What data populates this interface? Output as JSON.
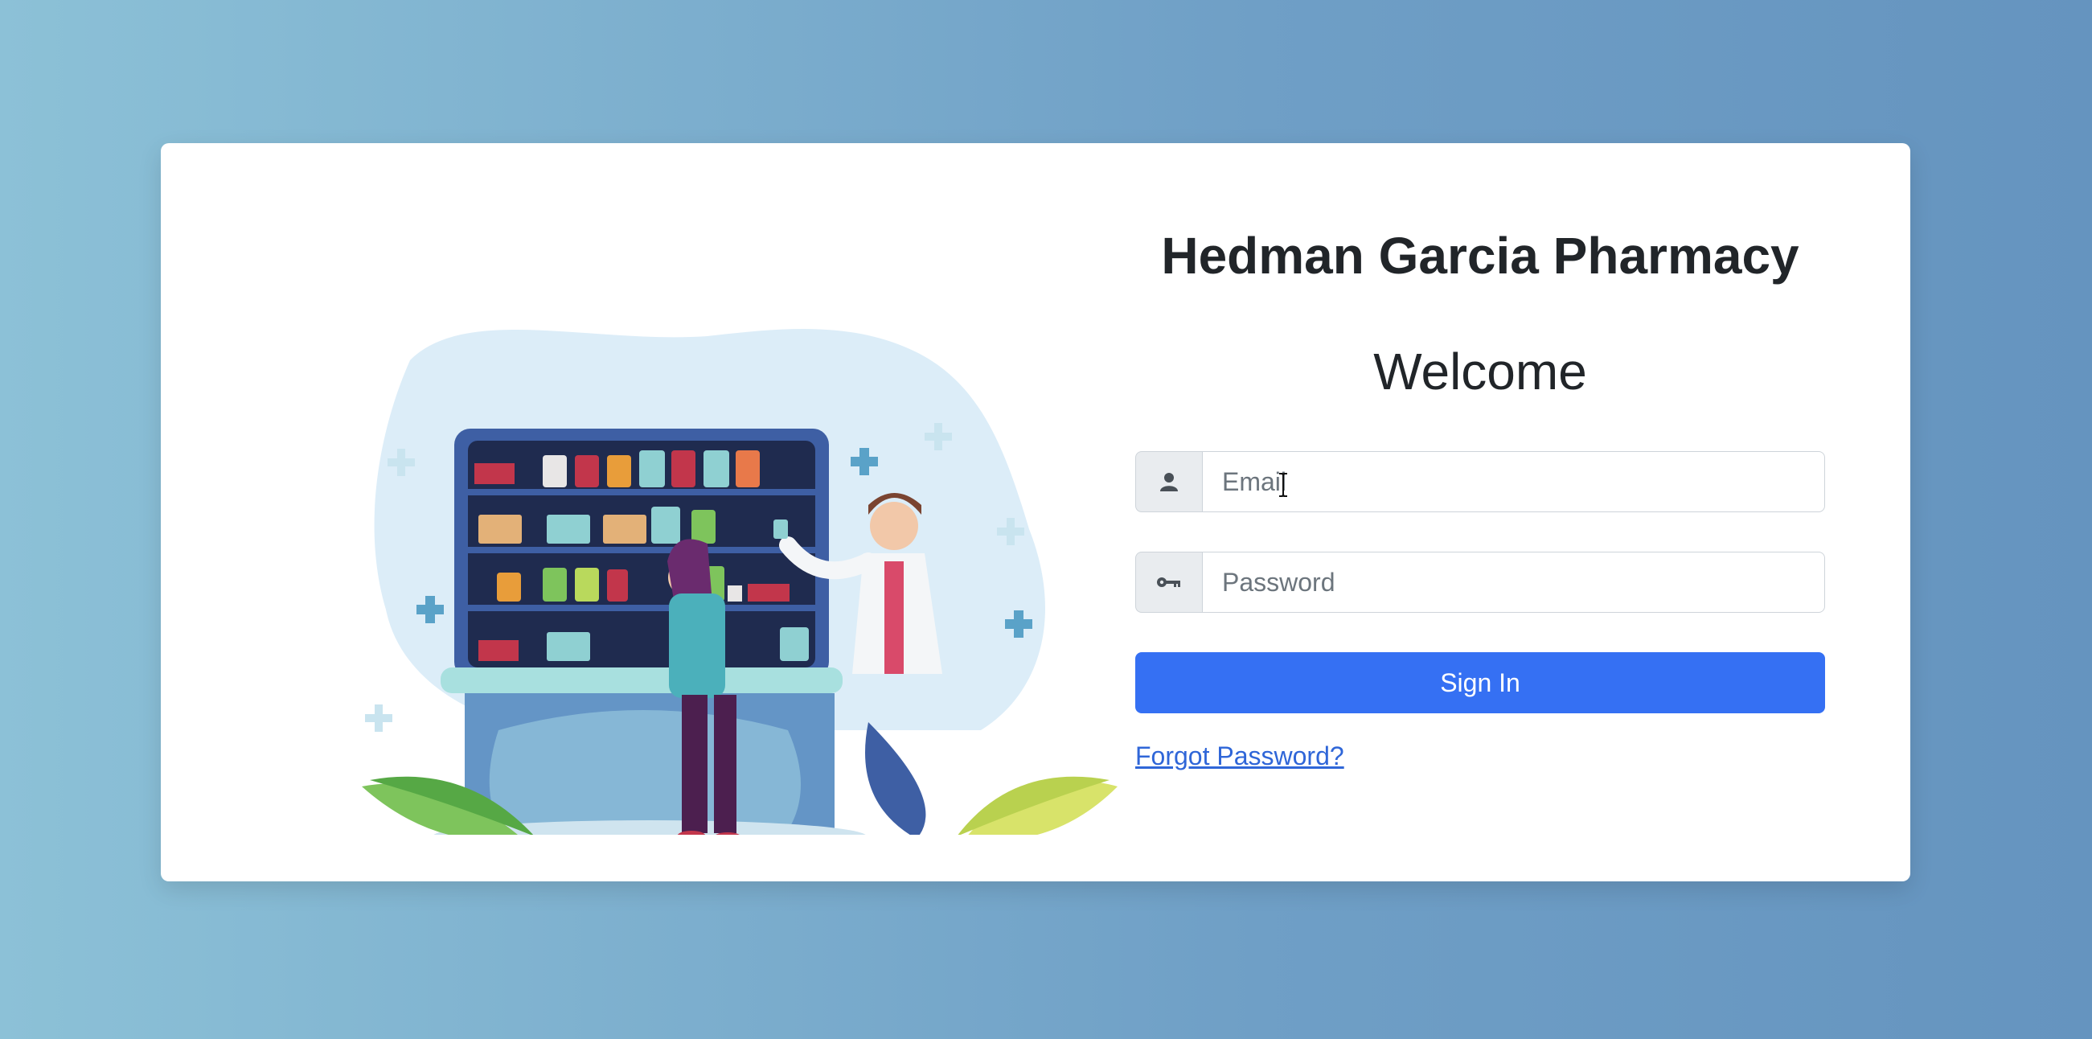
{
  "app": {
    "brand_title": "Hedman Garcia Pharmacy",
    "welcome_heading": "Welcome"
  },
  "login_form": {
    "email": {
      "placeholder": "Email",
      "value": "",
      "icon": "user-icon"
    },
    "password": {
      "placeholder": "Password",
      "value": "",
      "icon": "key-icon"
    },
    "sign_in_label": "Sign In",
    "forgot_password_label": "Forgot Password?"
  },
  "colors": {
    "background_start": "#8cc1d7",
    "background_end": "#6594bf",
    "primary_button": "#3570f3",
    "link": "#2f66d8",
    "heading_text": "#212529"
  },
  "illustration": {
    "icon": "pharmacy-illustration"
  }
}
